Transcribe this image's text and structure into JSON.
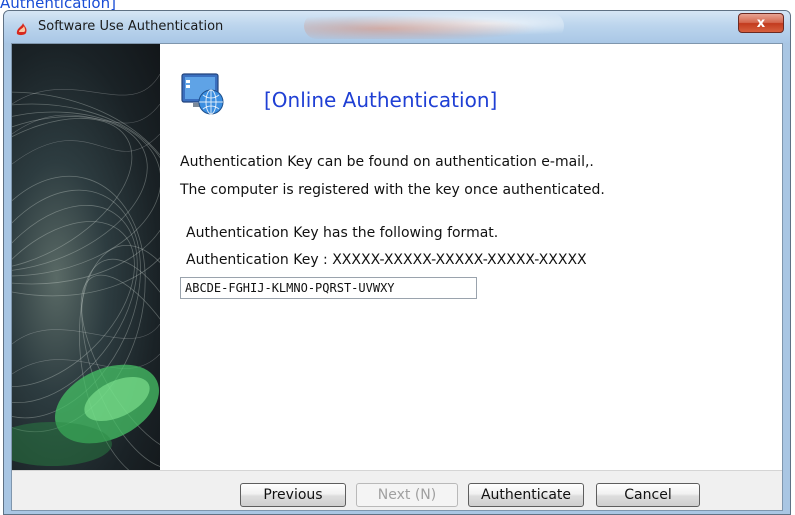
{
  "top_caption": "Authentication]",
  "window": {
    "title": "Software Use Authentication",
    "close_glyph": "x"
  },
  "content": {
    "heading": "[Online Authentication]",
    "lines": [
      "Authentication Key can be found on authentication e-mail,.",
      " The computer is registered with the key once authenticated.",
      "Authentication Key has the following format.",
      "Authentication Key : XXXXX-XXXXX-XXXXX-XXXXX-XXXXX"
    ],
    "key_input_value": "ABCDE-FGHIJ-KLMNO-PQRST-UVWXY"
  },
  "buttons": {
    "previous": "Previous",
    "next": "Next (N)",
    "authenticate": "Authenticate",
    "cancel": "Cancel"
  },
  "icons": {
    "app": "app-logo-icon",
    "heading": "network-globe-icon",
    "close": "close-icon"
  },
  "colors": {
    "heading": "#1f3fd4",
    "titlebar": "#bcd5ed",
    "close_button": "#c23a1d"
  }
}
